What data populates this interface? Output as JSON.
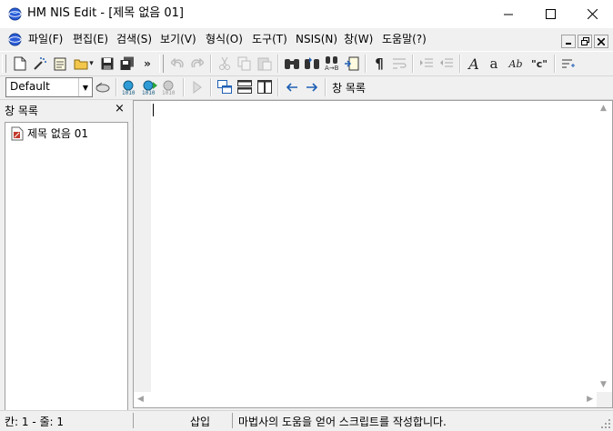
{
  "window": {
    "title": "HM NIS Edit - [제목 없음 01]"
  },
  "menu": {
    "items": [
      {
        "label": "파일(F)"
      },
      {
        "label": "편집(E)"
      },
      {
        "label": "검색(S)"
      },
      {
        "label": "보기(V)"
      },
      {
        "label": "형식(O)"
      },
      {
        "label": "도구(T)"
      },
      {
        "label": "NSIS(N)"
      },
      {
        "label": "창(W)"
      },
      {
        "label": "도움말(?)"
      }
    ]
  },
  "toolbar": {
    "overflow_label": "»",
    "dropdown_arrow": "▾",
    "font_A": "A",
    "font_a": "a",
    "font_Ab": "Ab",
    "quote_c": "\"c\"",
    "pilcrow": "¶"
  },
  "toolbar2": {
    "combo_value": "Default",
    "window_list_label": "창 목록"
  },
  "panel": {
    "title": "창 목록",
    "close": "×",
    "items": [
      {
        "label": "제목 없음 01"
      }
    ]
  },
  "status": {
    "position": "칸: 1 - 줄: 1",
    "mode": "삽입",
    "message": "마법사의 도움을 얻어 스크립트를 작성합니다."
  },
  "colors": {
    "accent": "#0078d7",
    "icon_blue": "#1f5fb4",
    "icon_red": "#c0392b"
  }
}
